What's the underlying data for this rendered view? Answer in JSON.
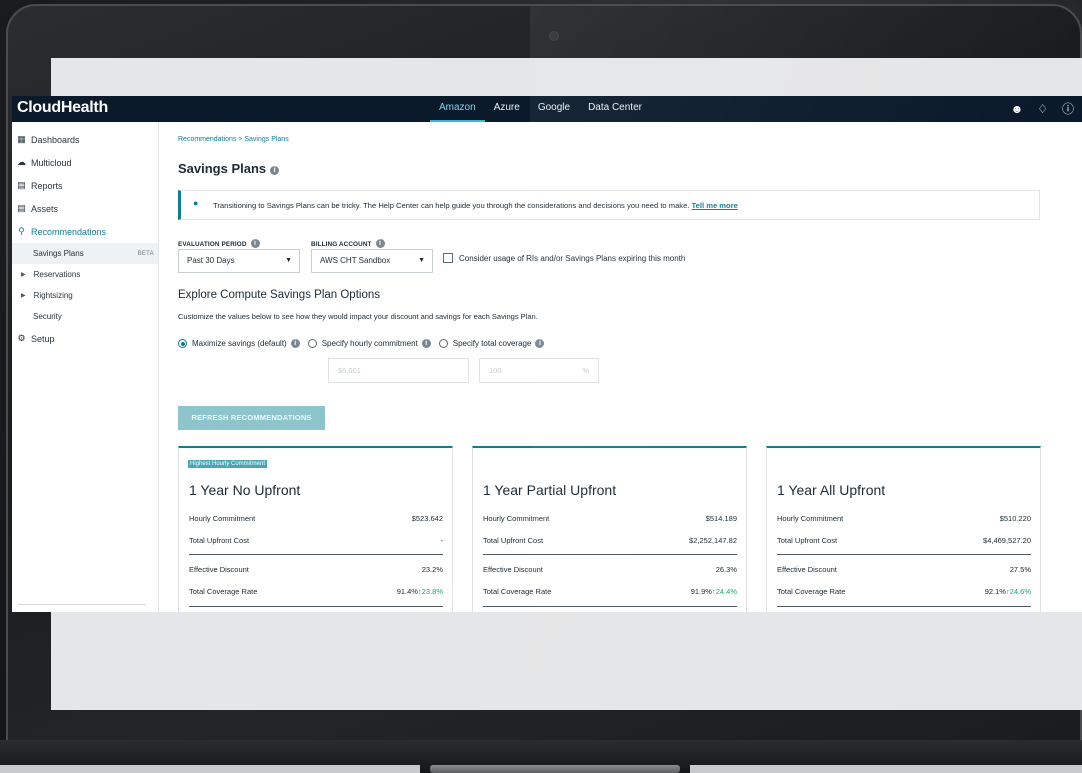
{
  "app": {
    "logo": "CloudHealth",
    "nav_tabs": [
      {
        "label": "Amazon",
        "active": true
      },
      {
        "label": "Azure",
        "active": false
      },
      {
        "label": "Google",
        "active": false
      },
      {
        "label": "Data Center",
        "active": false
      }
    ],
    "nav_icons": [
      "user-icon",
      "bell-icon",
      "help-icon"
    ]
  },
  "sidebar": {
    "items": [
      {
        "label": "Dashboards",
        "icon": "dashboard-icon"
      },
      {
        "label": "Multicloud",
        "icon": "cloud-icon"
      },
      {
        "label": "Reports",
        "icon": "bar-chart-icon"
      },
      {
        "label": "Assets",
        "icon": "assets-icon"
      },
      {
        "label": "Recommendations",
        "icon": "lightbulb-icon"
      }
    ],
    "sub_items": [
      {
        "label": "Savings Plans",
        "badge": "BETA"
      },
      {
        "label": "Reservations"
      },
      {
        "label": "Rightsizing"
      },
      {
        "label": "Security"
      }
    ],
    "setup": {
      "label": "Setup",
      "icon": "gear-icon"
    }
  },
  "main": {
    "breadcrumb": "Recommendations > Savings Plans",
    "title": "Savings Plans",
    "banner": {
      "message": "Transitioning to Savings Plans can be tricky. The Help Center can help guide you through the considerations and decisions you need to make.",
      "link": "Tell me more"
    },
    "evaluation_period": {
      "label": "EVALUATION PERIOD",
      "value": "Past 30 Days"
    },
    "billing_account": {
      "label": "BILLING ACCOUNT",
      "value": "AWS CHT Sandbox"
    },
    "consider_checkbox": "Consider usage of RIs and/or Savings Plans expiring this month",
    "explore_title": "Explore Compute Savings Plan Options",
    "explore_text": "Customize the values below to see how they would impact your discount and savings for each Savings Plan.",
    "radios": {
      "maximize": "Maximize savings (default)",
      "hourly": "Specify hourly commitment",
      "coverage": "Specify total coverage"
    },
    "hourly_placeholder": "$6.001",
    "coverage_placeholder": "100",
    "coverage_unit": "%",
    "refresh_button": "REFRESH RECOMMENDATIONS"
  },
  "cards": [
    {
      "tag": "Highest Hourly Commitment",
      "title": "1 Year No Upfront",
      "hourly_label": "Hourly Commitment",
      "hourly_value": "$523.642",
      "upfront_label": "Total Upfront Cost",
      "upfront_value": "-",
      "discount_label": "Effective Discount",
      "discount_value": "23.2%",
      "coverage_label": "Total Coverage Rate",
      "coverage_value": "91.4%",
      "coverage_delta": "23.8%"
    },
    {
      "tag": "",
      "title": "1 Year Partial Upfront",
      "hourly_label": "Hourly Commitment",
      "hourly_value": "$514.189",
      "upfront_label": "Total Upfront Cost",
      "upfront_value": "$2,252,147.82",
      "discount_label": "Effective Discount",
      "discount_value": "26.3%",
      "coverage_label": "Total Coverage Rate",
      "coverage_value": "91.9%",
      "coverage_delta": "24.4%"
    },
    {
      "tag": "",
      "title": "1 Year All Upfront",
      "hourly_label": "Hourly Commitment",
      "hourly_value": "$510.220",
      "upfront_label": "Total Upfront Cost",
      "upfront_value": "$4,469,527.20",
      "discount_label": "Effective Discount",
      "discount_value": "27.5%",
      "coverage_label": "Total Coverage Rate",
      "coverage_value": "92.1%",
      "coverage_delta": "24.6%"
    }
  ],
  "colors": {
    "accent": "#127d93",
    "nav_bg": "#0a1a2b",
    "positive": "#1ba66b"
  }
}
